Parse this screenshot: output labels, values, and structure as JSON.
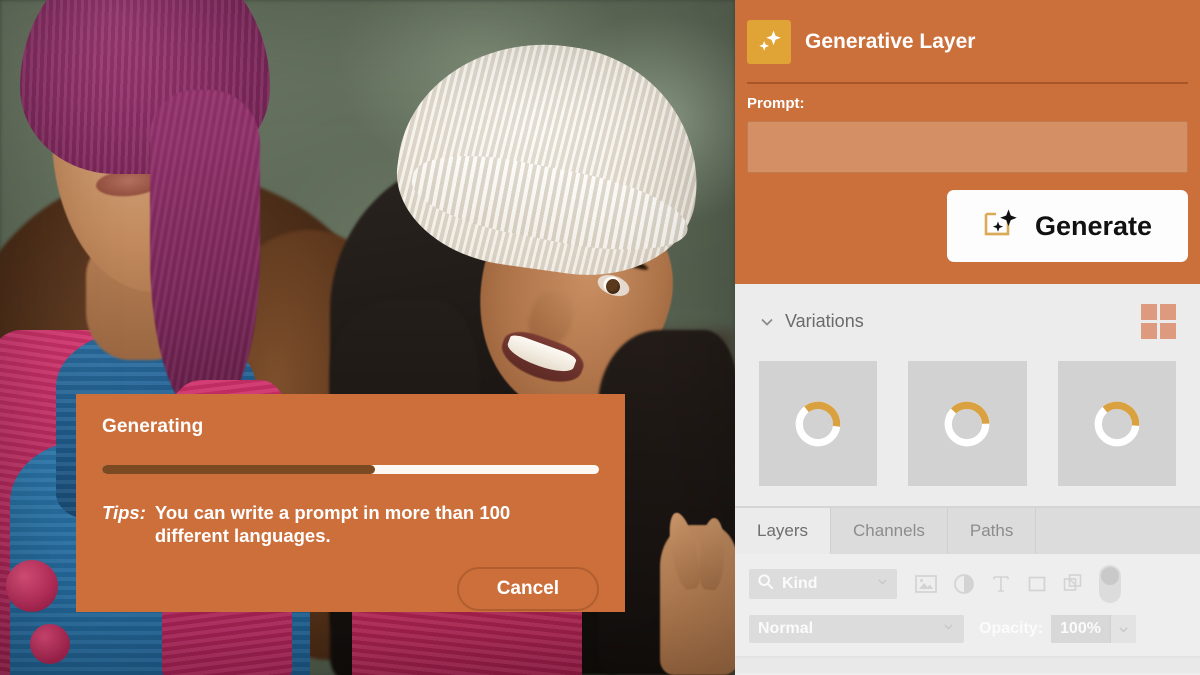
{
  "app": {
    "accent_orange": "#cb6f3b",
    "accent_gold": "#e0a335",
    "panel_gray": "#ececec"
  },
  "canvas": {
    "name": "photo-canvas",
    "description": "Photo of two young women wearing knit beanies outdoors"
  },
  "generating_dialog": {
    "title": "Generating",
    "progress_percent": 55,
    "tips_label": "Tips:",
    "tips_text": "You can write a prompt in more than 100 different languages.",
    "cancel_label": "Cancel"
  },
  "generative_layer": {
    "icon": "sparkles-icon",
    "title": "Generative Layer",
    "prompt_label": "Prompt:",
    "prompt_value": "",
    "prompt_placeholder": "",
    "generate_label": "Generate",
    "generate_icon": "generative-fill-icon"
  },
  "variations": {
    "chevron": "chevron-down-icon",
    "title": "Variations",
    "grid_icon": "grid-2x2-icon",
    "thumbnails": [
      {
        "name": "variation-1",
        "state": "loading"
      },
      {
        "name": "variation-2",
        "state": "loading"
      },
      {
        "name": "variation-3",
        "state": "loading"
      }
    ]
  },
  "layers_panel": {
    "tabs": [
      {
        "label": "Layers",
        "active": true
      },
      {
        "label": "Channels",
        "active": false
      },
      {
        "label": "Paths",
        "active": false
      }
    ],
    "filter": {
      "search_icon": "search-icon",
      "kind_label": "Kind",
      "kind_chevron": "chevron-down-icon",
      "icons": [
        "pixel-layer-icon",
        "adjustment-layer-icon",
        "type-layer-icon",
        "shape-layer-icon",
        "smart-object-icon"
      ],
      "toggle": "filter-toggle"
    },
    "blend": {
      "mode": "Normal",
      "mode_chevron": "chevron-down-icon",
      "opacity_label": "Opacity:",
      "opacity_value": "100%",
      "opacity_chevron": "chevron-down-icon"
    }
  }
}
